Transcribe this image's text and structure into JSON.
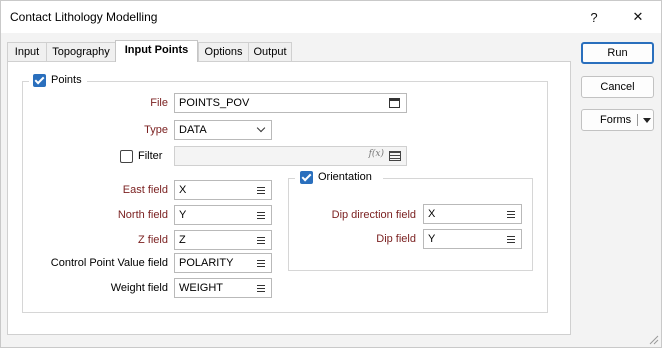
{
  "window": {
    "title": "Contact Lithology Modelling",
    "help_label": "?",
    "close_label": "✕"
  },
  "tabs": [
    {
      "label": "Input"
    },
    {
      "label": "Topography"
    },
    {
      "label": "Input Points"
    },
    {
      "label": "Options"
    },
    {
      "label": "Output"
    }
  ],
  "points_group": {
    "label": "Points",
    "checked": true,
    "file": {
      "label": "File",
      "value": "POINTS_POV"
    },
    "type": {
      "label": "Type",
      "value": "DATA"
    },
    "filter": {
      "label": "Filter",
      "value": "",
      "checked": false,
      "fx_label": "f(x)"
    },
    "east": {
      "label": "East field",
      "value": "X"
    },
    "north": {
      "label": "North field",
      "value": "Y"
    },
    "z": {
      "label": "Z field",
      "value": "Z"
    },
    "cpv": {
      "label": "Control Point Value field",
      "value": "POLARITY"
    },
    "weight": {
      "label": "Weight field",
      "value": "WEIGHT"
    }
  },
  "orientation_group": {
    "label": "Orientation",
    "checked": true,
    "dip_direction": {
      "label": "Dip direction field",
      "value": "X"
    },
    "dip": {
      "label": "Dip field",
      "value": "Y"
    }
  },
  "buttons": {
    "run": "Run",
    "cancel": "Cancel",
    "forms": "Forms"
  },
  "colors": {
    "accent": "#2a6fbd",
    "required_label": "#7a1f1f"
  }
}
